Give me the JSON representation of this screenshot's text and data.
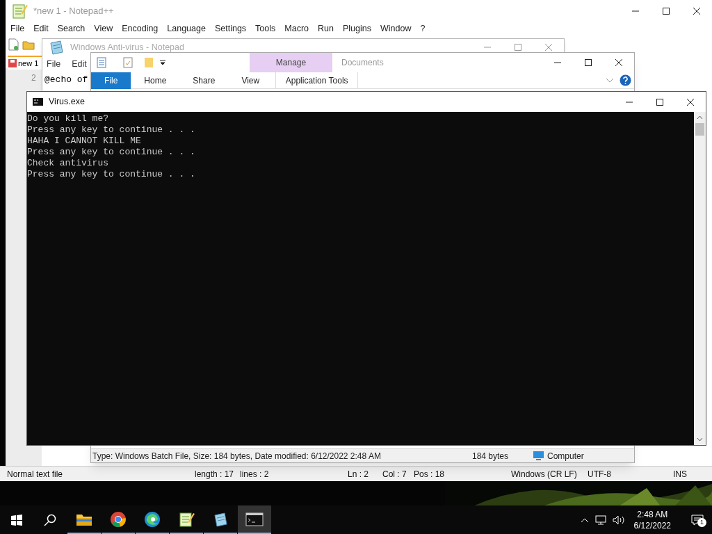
{
  "notepadpp": {
    "title": "*new 1 - Notepad++",
    "menu": [
      "File",
      "Edit",
      "Search",
      "View",
      "Encoding",
      "Language",
      "Settings",
      "Tools",
      "Macro",
      "Run",
      "Plugins",
      "Window",
      "?"
    ],
    "tab": "new 1",
    "line_number": "2",
    "status_bar": [
      "Normal text file",
      "length : 17",
      "lines : 2",
      "Ln : 2",
      "Col : 7",
      "Pos : 18",
      "Windows (CR LF)",
      "UTF-8",
      "INS"
    ]
  },
  "notepad": {
    "title": "Windows Anti-virus - Notepad",
    "menu": [
      "File",
      "Edit"
    ],
    "text": "@echo of"
  },
  "explorer": {
    "tabs": [
      {
        "label": "File",
        "selected": true
      },
      {
        "label": "Home",
        "selected": false
      },
      {
        "label": "Share",
        "selected": false
      },
      {
        "label": "View",
        "selected": false
      }
    ],
    "context_group": "Manage",
    "context_tab": "Application Tools",
    "title": "Documents",
    "status_details": "Type: Windows Batch File, Size: 184 bytes, Date modified: 6/12/2022 2:48 AM",
    "status_size": "184 bytes",
    "status_location": "Computer"
  },
  "console": {
    "title": "Virus.exe",
    "lines": [
      "Do you kill me?",
      "Press any key to continue . . .",
      "HAHA I CANNOT KILL ME",
      "Press any key to continue . . .",
      "Check antivirus",
      "Press any key to continue . . ."
    ]
  },
  "taskbar": {
    "apps": [
      {
        "kind": "folder",
        "selected": false
      },
      {
        "kind": "chrome",
        "selected": false
      },
      {
        "kind": "edge",
        "selected": false
      },
      {
        "kind": "notepadpp",
        "selected": false
      },
      {
        "kind": "notepad",
        "selected": false
      },
      {
        "kind": "console",
        "selected": true
      }
    ],
    "time": "2:48 AM",
    "date": "6/12/2022",
    "notifications": "1"
  }
}
